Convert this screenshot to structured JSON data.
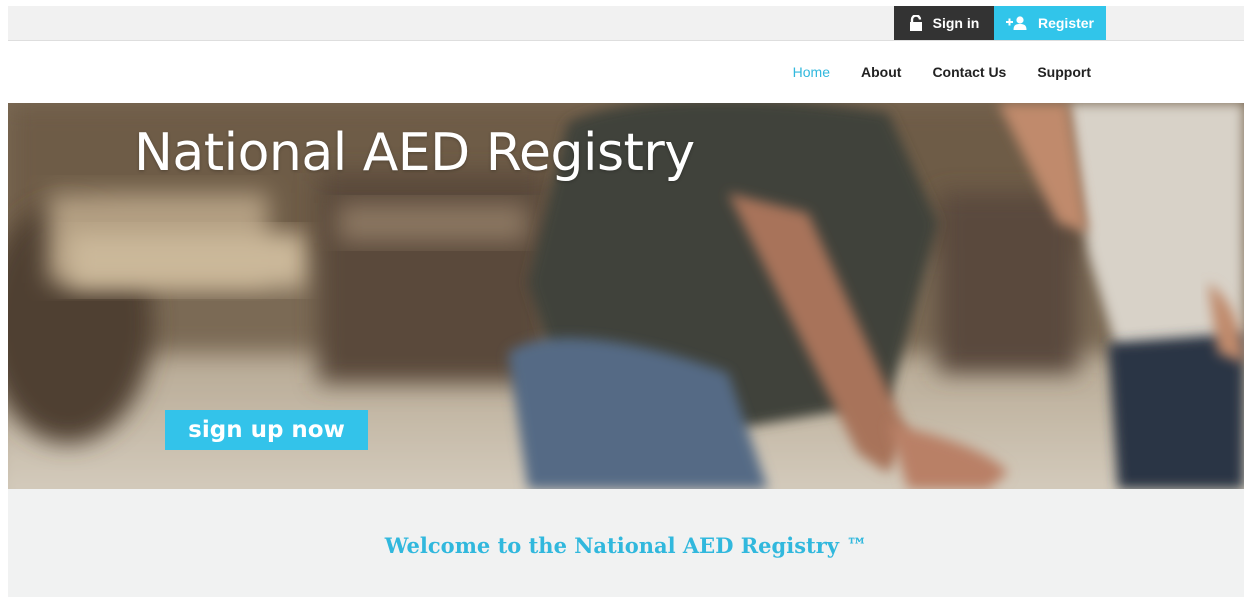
{
  "header": {
    "signin_label": "Sign in",
    "register_label": "Register"
  },
  "nav": {
    "items": [
      {
        "label": "Home",
        "active": true
      },
      {
        "label": "About",
        "active": false
      },
      {
        "label": "Contact Us",
        "active": false
      },
      {
        "label": "Support",
        "active": false
      }
    ]
  },
  "hero": {
    "title": "National AED Registry",
    "cta_label": "sign up now"
  },
  "welcome": {
    "text": "Welcome to the National AED Registry ™"
  },
  "colors": {
    "accent": "#31c5ea",
    "dark": "#333333",
    "nav_active": "#31b8dd"
  },
  "icons": {
    "signin": "padlock-open-icon",
    "register": "add-user-icon"
  }
}
